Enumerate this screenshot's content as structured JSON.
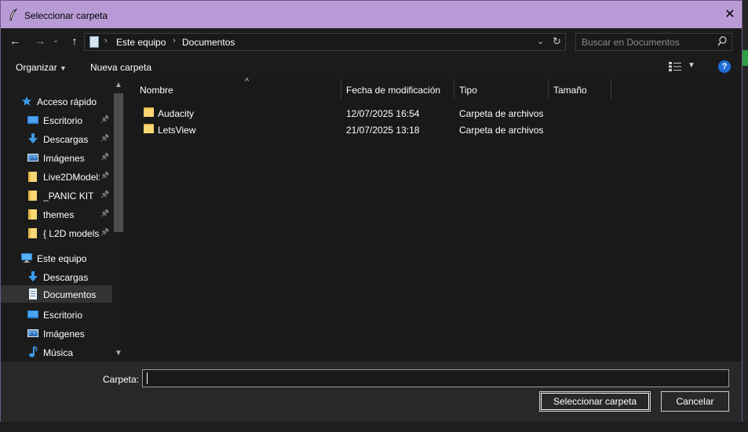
{
  "window": {
    "title": "Seleccionar carpeta",
    "close_glyph": "✕"
  },
  "nav": {
    "back_glyph": "←",
    "forward_glyph": "→",
    "recent_glyph": "⌄",
    "up_glyph": "↑",
    "breadcrumbs": [
      "Este equipo",
      "Documentos"
    ],
    "search_placeholder": "Buscar en Documentos"
  },
  "toolbar": {
    "organize_label": "Organizar",
    "new_folder_label": "Nueva carpeta",
    "help_glyph": "?"
  },
  "sidebar": {
    "items": [
      {
        "label": "Acceso rápido",
        "icon": "star-icon",
        "level": 0,
        "pinned": false
      },
      {
        "label": "Escritorio",
        "icon": "desktop-icon",
        "level": 1,
        "pinned": true
      },
      {
        "label": "Descargas",
        "icon": "download-icon",
        "level": 1,
        "pinned": true
      },
      {
        "label": "Imágenes",
        "icon": "pictures-icon",
        "level": 1,
        "pinned": true
      },
      {
        "label": "Live2DModel:",
        "icon": "folder-icon",
        "level": 1,
        "pinned": true
      },
      {
        "label": "_PANIC KIT",
        "icon": "folder-icon",
        "level": 1,
        "pinned": true
      },
      {
        "label": "themes",
        "icon": "folder-icon",
        "level": 1,
        "pinned": true
      },
      {
        "label": "{ L2D models}",
        "icon": "folder-icon",
        "level": 1,
        "pinned": true
      },
      {
        "label": "Este equipo",
        "icon": "computer-icon",
        "level": 0,
        "pinned": false
      },
      {
        "label": "Descargas",
        "icon": "download-icon",
        "level": 1,
        "pinned": false
      },
      {
        "label": "Documentos",
        "icon": "documents-icon",
        "level": 1,
        "pinned": false,
        "selected": true
      },
      {
        "label": "Escritorio",
        "icon": "desktop-icon",
        "level": 1,
        "pinned": false
      },
      {
        "label": "Imágenes",
        "icon": "pictures-icon",
        "level": 1,
        "pinned": false
      },
      {
        "label": "Música",
        "icon": "music-icon",
        "level": 1,
        "pinned": false
      }
    ]
  },
  "files": {
    "columns": [
      "Nombre",
      "Fecha de modificación",
      "Tipo",
      "Tamaño"
    ],
    "rows": [
      {
        "name": "Audacity",
        "modified": "12/07/2025 16:54",
        "type": "Carpeta de archivos",
        "size": ""
      },
      {
        "name": "LetsView",
        "modified": "21/07/2025 13:18",
        "type": "Carpeta de archivos",
        "size": ""
      }
    ]
  },
  "footer": {
    "folder_label": "Carpeta:",
    "folder_value": "",
    "select_button": "Seleccionar carpeta",
    "cancel_button": "Cancelar"
  }
}
